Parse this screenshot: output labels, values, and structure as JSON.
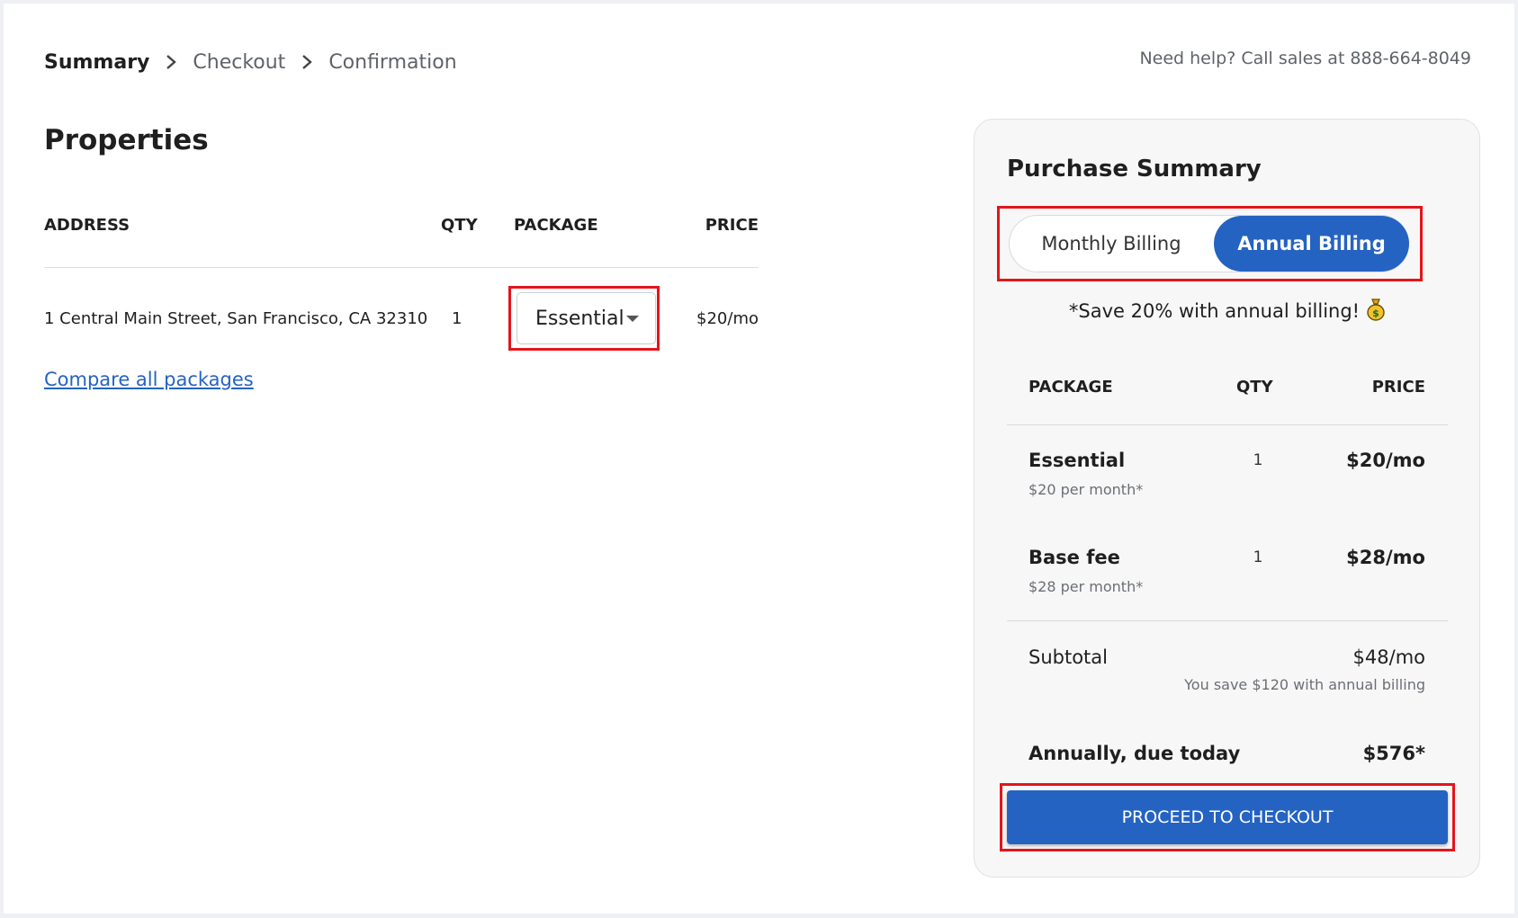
{
  "breadcrumb": {
    "steps": [
      "Summary",
      "Checkout",
      "Confirmation"
    ]
  },
  "help": {
    "text": "Need help? Call sales at",
    "phone": "888-664-8049"
  },
  "properties": {
    "title": "Properties",
    "columns": [
      "ADDRESS",
      "QTY",
      "PACKAGE",
      "PRICE"
    ],
    "rows": [
      {
        "address": "1 Central Main Street, San Francisco, CA 32310",
        "qty": "1",
        "package": "Essential",
        "price": "$20/mo"
      }
    ],
    "compare_link": "Compare all packages"
  },
  "summary": {
    "title": "Purchase Summary",
    "billing": {
      "monthly": "Monthly Billing",
      "annual": "Annual Billing",
      "selected": "Annual Billing"
    },
    "save_note": "*Save 20% with annual billing!",
    "columns": [
      "PACKAGE",
      "QTY",
      "PRICE"
    ],
    "items": [
      {
        "name": "Essential",
        "sub": "$20 per month*",
        "qty": "1",
        "price": "$20/mo"
      },
      {
        "name": "Base fee",
        "sub": "$28 per month*",
        "qty": "1",
        "price": "$28/mo"
      }
    ],
    "subtotal": {
      "label": "Subtotal",
      "value": "$48/mo",
      "note": "You save $120 with annual billing"
    },
    "due": {
      "label": "Annually, due today",
      "value": "$576*"
    },
    "cta": "PROCEED TO CHECKOUT"
  },
  "colors": {
    "accent": "#2563c2",
    "highlight": "#e3151b",
    "panel_bg": "#f7f7f7"
  },
  "icons": [
    "chevron-right-icon",
    "chevron-down-icon",
    "money-bag-icon"
  ]
}
